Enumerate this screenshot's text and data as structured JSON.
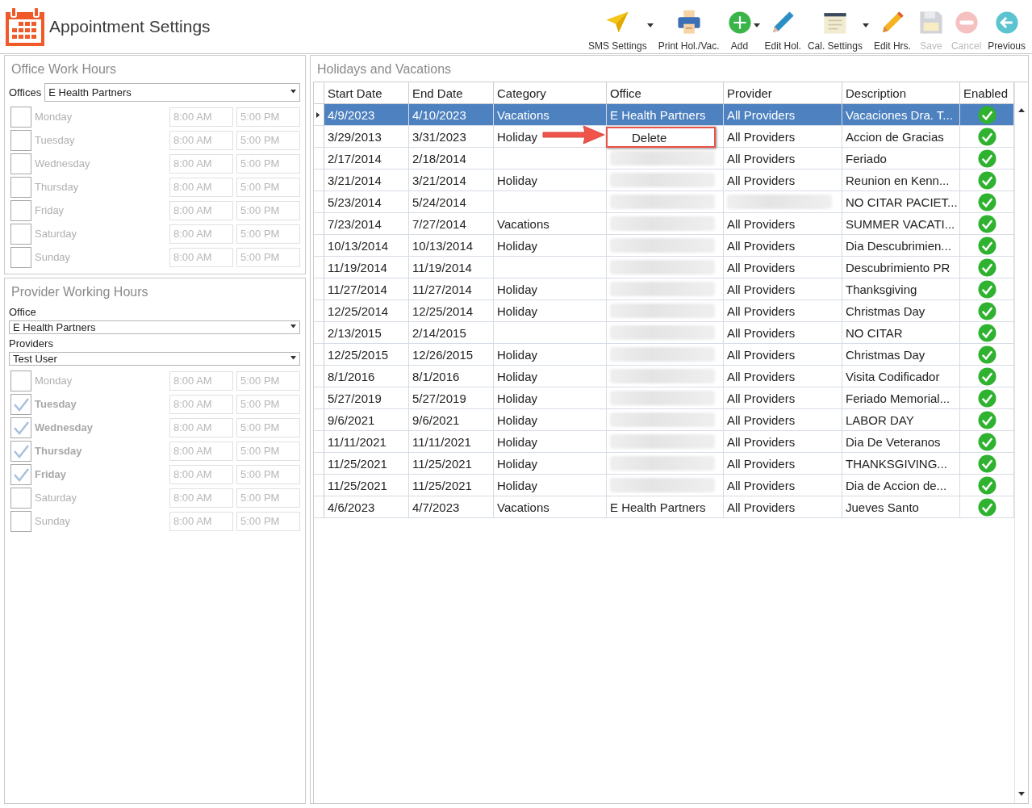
{
  "header": {
    "title": "Appointment Settings"
  },
  "toolbar": [
    {
      "kind": "send",
      "label": "SMS Settings",
      "disabled": false,
      "dropdown": true
    },
    {
      "kind": "print",
      "label": "Print Hol./Vac.",
      "disabled": false,
      "dropdown": false
    },
    {
      "kind": "add",
      "label": "Add",
      "disabled": false,
      "dropdown": true
    },
    {
      "kind": "pen",
      "label": "Edit Hol.",
      "disabled": false,
      "dropdown": false
    },
    {
      "kind": "notepad",
      "label": "Cal. Settings",
      "disabled": false,
      "dropdown": true
    },
    {
      "kind": "pencil",
      "label": "Edit Hrs.",
      "disabled": false,
      "dropdown": false
    },
    {
      "kind": "save",
      "label": "Save",
      "disabled": true,
      "dropdown": false
    },
    {
      "kind": "cancel",
      "label": "Cancel",
      "disabled": true,
      "dropdown": false
    },
    {
      "kind": "back",
      "label": "Previous",
      "disabled": false,
      "dropdown": false
    }
  ],
  "office_hours": {
    "title": "Office Work Hours",
    "fields": [
      {
        "label": "Offices",
        "value": "E Health Partners",
        "inline": true
      }
    ],
    "days": [
      {
        "day": "Monday",
        "checked": false,
        "start": "8:00 AM",
        "end": "5:00 PM"
      },
      {
        "day": "Tuesday",
        "checked": false,
        "start": "8:00 AM",
        "end": "5:00 PM"
      },
      {
        "day": "Wednesday",
        "checked": false,
        "start": "8:00 AM",
        "end": "5:00 PM"
      },
      {
        "day": "Thursday",
        "checked": false,
        "start": "8:00 AM",
        "end": "5:00 PM"
      },
      {
        "day": "Friday",
        "checked": false,
        "start": "8:00 AM",
        "end": "5:00 PM"
      },
      {
        "day": "Saturday",
        "checked": false,
        "start": "8:00 AM",
        "end": "5:00 PM"
      },
      {
        "day": "Sunday",
        "checked": false,
        "start": "8:00 AM",
        "end": "5:00 PM"
      }
    ]
  },
  "provider_hours": {
    "title": "Provider Working Hours",
    "fields": [
      {
        "label": "Office",
        "value": "E Health Partners",
        "inline": false
      },
      {
        "label": "Providers",
        "value": "Test User",
        "inline": false
      }
    ],
    "days": [
      {
        "day": "Monday",
        "checked": false,
        "start": "8:00 AM",
        "end": "5:00 PM"
      },
      {
        "day": "Tuesday",
        "checked": true,
        "start": "8:00 AM",
        "end": "5:00 PM"
      },
      {
        "day": "Wednesday",
        "checked": true,
        "start": "8:00 AM",
        "end": "5:00 PM"
      },
      {
        "day": "Thursday",
        "checked": true,
        "start": "8:00 AM",
        "end": "5:00 PM"
      },
      {
        "day": "Friday",
        "checked": true,
        "start": "8:00 AM",
        "end": "5:00 PM"
      },
      {
        "day": "Saturday",
        "checked": false,
        "start": "8:00 AM",
        "end": "5:00 PM"
      },
      {
        "day": "Sunday",
        "checked": false,
        "start": "8:00 AM",
        "end": "5:00 PM"
      }
    ]
  },
  "holidays": {
    "title": "Holidays and Vacations",
    "columns": [
      "Start Date",
      "End Date",
      "Category",
      "Office",
      "Provider",
      "Description",
      "Enabled"
    ],
    "rows": [
      {
        "selected": true,
        "start": "4/9/2023",
        "end": "4/10/2023",
        "category": "Vacations",
        "office": "E Health Partners",
        "provider": "All Providers",
        "description": "Vacaciones Dra. T...",
        "enabled": true
      },
      {
        "selected": false,
        "start": "3/29/2013",
        "end": "3/31/2023",
        "category": "Holiday",
        "provider": "All Providers",
        "description": "Accion de Gracias",
        "enabled": true
      },
      {
        "selected": false,
        "start": "2/17/2014",
        "end": "2/18/2014",
        "office_redacted": true,
        "provider": "All Providers",
        "description": "Feriado",
        "enabled": true
      },
      {
        "selected": false,
        "start": "3/21/2014",
        "end": "3/21/2014",
        "category": "Holiday",
        "office_redacted": true,
        "provider": "All Providers",
        "description": "Reunion en Kenn...",
        "enabled": true
      },
      {
        "selected": false,
        "start": "5/23/2014",
        "end": "5/24/2014",
        "office_redacted": true,
        "provider_redacted": true,
        "description": "NO CITAR PACIET...",
        "enabled": true
      },
      {
        "selected": false,
        "start": "7/23/2014",
        "end": "7/27/2014",
        "category": "Vacations",
        "office_redacted": true,
        "provider": "All Providers",
        "description": "SUMMER VACATI...",
        "enabled": true
      },
      {
        "selected": false,
        "start": "10/13/2014",
        "end": "10/13/2014",
        "category": "Holiday",
        "office_redacted": true,
        "provider": "All Providers",
        "description": "Dia Descubrimien...",
        "enabled": true
      },
      {
        "selected": false,
        "start": "11/19/2014",
        "end": "11/19/2014",
        "office_redacted": true,
        "provider": "All Providers",
        "description": "Descubrimiento PR",
        "enabled": true
      },
      {
        "selected": false,
        "start": "11/27/2014",
        "end": "11/27/2014",
        "category": "Holiday",
        "office_redacted": true,
        "provider": "All Providers",
        "description": "Thanksgiving",
        "enabled": true
      },
      {
        "selected": false,
        "start": "12/25/2014",
        "end": "12/25/2014",
        "category": "Holiday",
        "office_redacted": true,
        "provider": "All Providers",
        "description": "Christmas Day",
        "enabled": true
      },
      {
        "selected": false,
        "start": "2/13/2015",
        "end": "2/14/2015",
        "office_redacted": true,
        "provider": "All Providers",
        "description": "NO CITAR",
        "enabled": true
      },
      {
        "selected": false,
        "start": "12/25/2015",
        "end": "12/26/2015",
        "category": "Holiday",
        "office_redacted": true,
        "provider": "All Providers",
        "description": "Christmas Day",
        "enabled": true
      },
      {
        "selected": false,
        "start": "8/1/2016",
        "end": "8/1/2016",
        "category": "Holiday",
        "office_redacted": true,
        "provider": "All Providers",
        "description": "Visita Codificador",
        "enabled": true
      },
      {
        "selected": false,
        "start": "5/27/2019",
        "end": "5/27/2019",
        "category": "Holiday",
        "office_redacted": true,
        "provider": "All Providers",
        "description": "Feriado Memorial...",
        "enabled": true
      },
      {
        "selected": false,
        "start": "9/6/2021",
        "end": "9/6/2021",
        "category": "Holiday",
        "office_redacted": true,
        "provider": "All Providers",
        "description": "LABOR DAY",
        "enabled": true
      },
      {
        "selected": false,
        "start": "11/11/2021",
        "end": "11/11/2021",
        "category": "Holiday",
        "office_redacted": true,
        "provider": "All Providers",
        "description": "Dia De Veteranos",
        "enabled": true
      },
      {
        "selected": false,
        "start": "11/25/2021",
        "end": "11/25/2021",
        "category": "Holiday",
        "office_redacted": true,
        "provider": "All Providers",
        "description": "THANKSGIVING...",
        "enabled": true
      },
      {
        "selected": false,
        "start": "11/25/2021",
        "end": "11/25/2021",
        "category": "Holiday",
        "office_redacted": true,
        "provider": "All Providers",
        "description": "Dia de Accion de...",
        "enabled": true
      },
      {
        "selected": false,
        "start": "4/6/2023",
        "end": "4/7/2023",
        "category": "Vacations",
        "office": "E Health Partners",
        "provider": "All Providers",
        "description": "Jueves Santo",
        "enabled": true
      }
    ],
    "context_menu": {
      "items": [
        "Delete"
      ]
    }
  }
}
